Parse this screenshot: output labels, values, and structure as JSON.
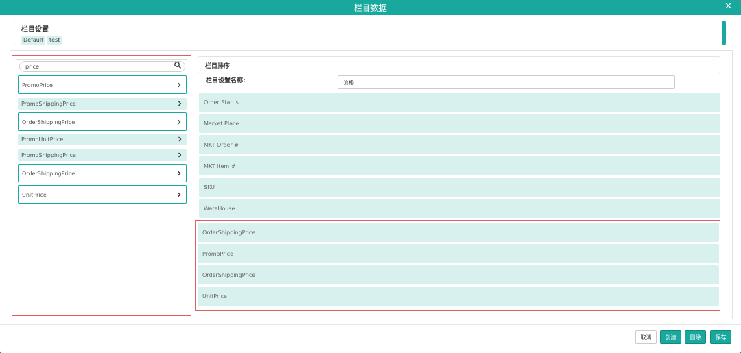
{
  "modal": {
    "title": "栏目数据",
    "close_glyph": "✕"
  },
  "settings": {
    "title": "栏目设置",
    "tags": [
      "Default",
      "test"
    ]
  },
  "search": {
    "value": "price",
    "placeholder": ""
  },
  "field_list": [
    {
      "label": "PromoPrice",
      "style": "boxed"
    },
    {
      "label": "PromoShippingPrice",
      "style": "filled"
    },
    {
      "label": "OrderShippingPrice",
      "style": "boxed"
    },
    {
      "label": "PromoUnitPrice",
      "style": "filled"
    },
    {
      "label": "PromoShippingPrice",
      "style": "filled"
    },
    {
      "label": "OrderShippingPrice",
      "style": "boxed"
    },
    {
      "label": "UnitPrice",
      "style": "boxed"
    }
  ],
  "sort_panel": {
    "title": "栏目排序",
    "name_label": "栏目设置名称:",
    "name_value": "价格",
    "columns": [
      "Order Status",
      "Market Place",
      "MKT Order #",
      "MKT Item #",
      "SKU",
      "WareHouse"
    ],
    "added_columns": [
      "OrderShippingPrice",
      "PromoPrice",
      "OrderShippingPrice",
      "UnitPrice"
    ]
  },
  "buttons": {
    "cancel": "取消",
    "create": "创建",
    "delete": "删除",
    "save": "保存"
  },
  "colors": {
    "accent": "#19a89d",
    "row_fill": "#d8f0ee",
    "highlight": "#e06060"
  }
}
